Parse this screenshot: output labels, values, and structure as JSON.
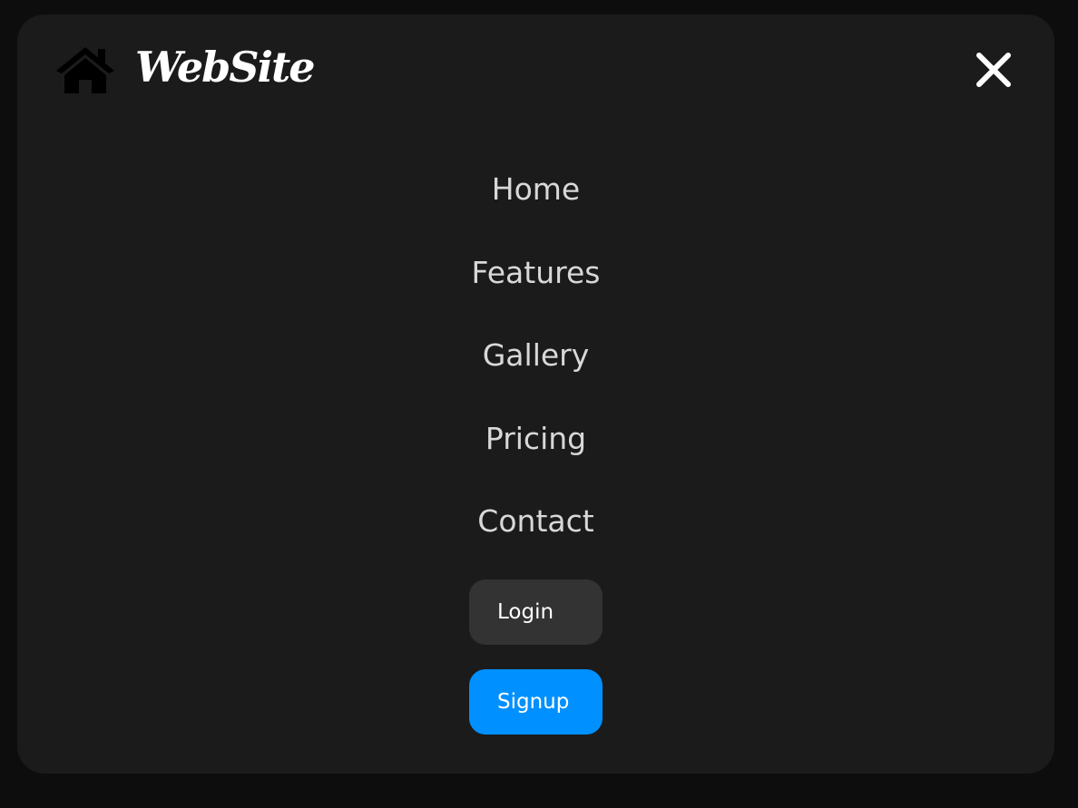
{
  "header": {
    "brand_name": "WebSite",
    "brand_icon": "home-icon",
    "close_icon": "close-icon"
  },
  "menu": {
    "items": [
      {
        "label": "Home"
      },
      {
        "label": "Features"
      },
      {
        "label": "Gallery"
      },
      {
        "label": "Pricing"
      },
      {
        "label": "Contact"
      }
    ]
  },
  "auth": {
    "login_label": "Login",
    "signup_label": "Signup"
  },
  "colors": {
    "page_background": "#0d0d0d",
    "panel_background": "#1b1b1b",
    "menu_text": "#d8d8d8",
    "login_button": "#333333",
    "signup_button": "#0090ff",
    "white": "#ffffff"
  }
}
